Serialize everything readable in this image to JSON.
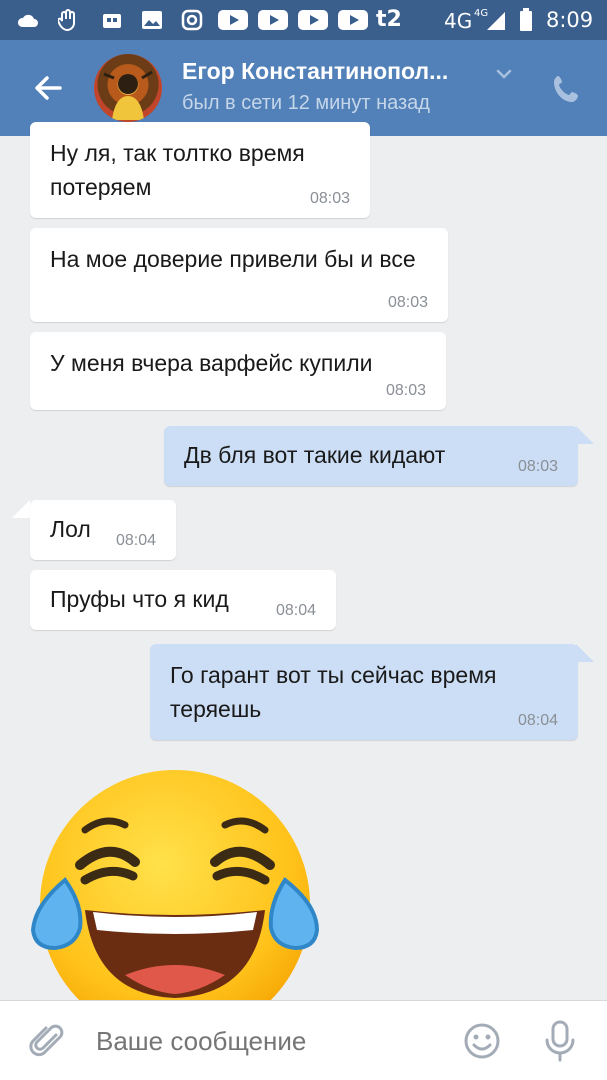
{
  "status_bar": {
    "icons": [
      "cloud-icon",
      "hand-icon",
      "game-icon",
      "gallery-icon",
      "instagram-icon",
      "youtube-icon",
      "youtube-icon",
      "youtube-icon",
      "youtube-icon"
    ],
    "carrier": "t2",
    "network": "4G",
    "network_sup": "4G",
    "time": "8:09"
  },
  "header": {
    "contact_name": "Егор Константинопол...",
    "status": "был в сети 12 минут назад"
  },
  "messages": [
    {
      "direction": "in",
      "text": "Ну ля, так толтко время потеряем",
      "time": "08:03"
    },
    {
      "direction": "in",
      "text": "На мое доверие привели бы и все",
      "time": "08:03"
    },
    {
      "direction": "in",
      "text": "У меня вчера варфейс купили",
      "time": "08:03"
    },
    {
      "direction": "out",
      "text": "Дв бля вот такие кидают",
      "time": "08:03"
    },
    {
      "direction": "in",
      "text": "Лол",
      "time": "08:04"
    },
    {
      "direction": "in",
      "text": "Пруфы что я кид",
      "time": "08:04"
    },
    {
      "direction": "out",
      "text": "Го гарант вот ты сейчас время теряешь",
      "time": "08:04"
    }
  ],
  "sticker": {
    "name": "laughing-tears-emoji"
  },
  "compose": {
    "placeholder": "Ваше сообщение"
  },
  "colors": {
    "status_bar": "#3a5f8c",
    "header": "#5181b8",
    "background": "#edeef0",
    "incoming_bubble": "#ffffff",
    "outgoing_bubble": "#ccdef5"
  }
}
